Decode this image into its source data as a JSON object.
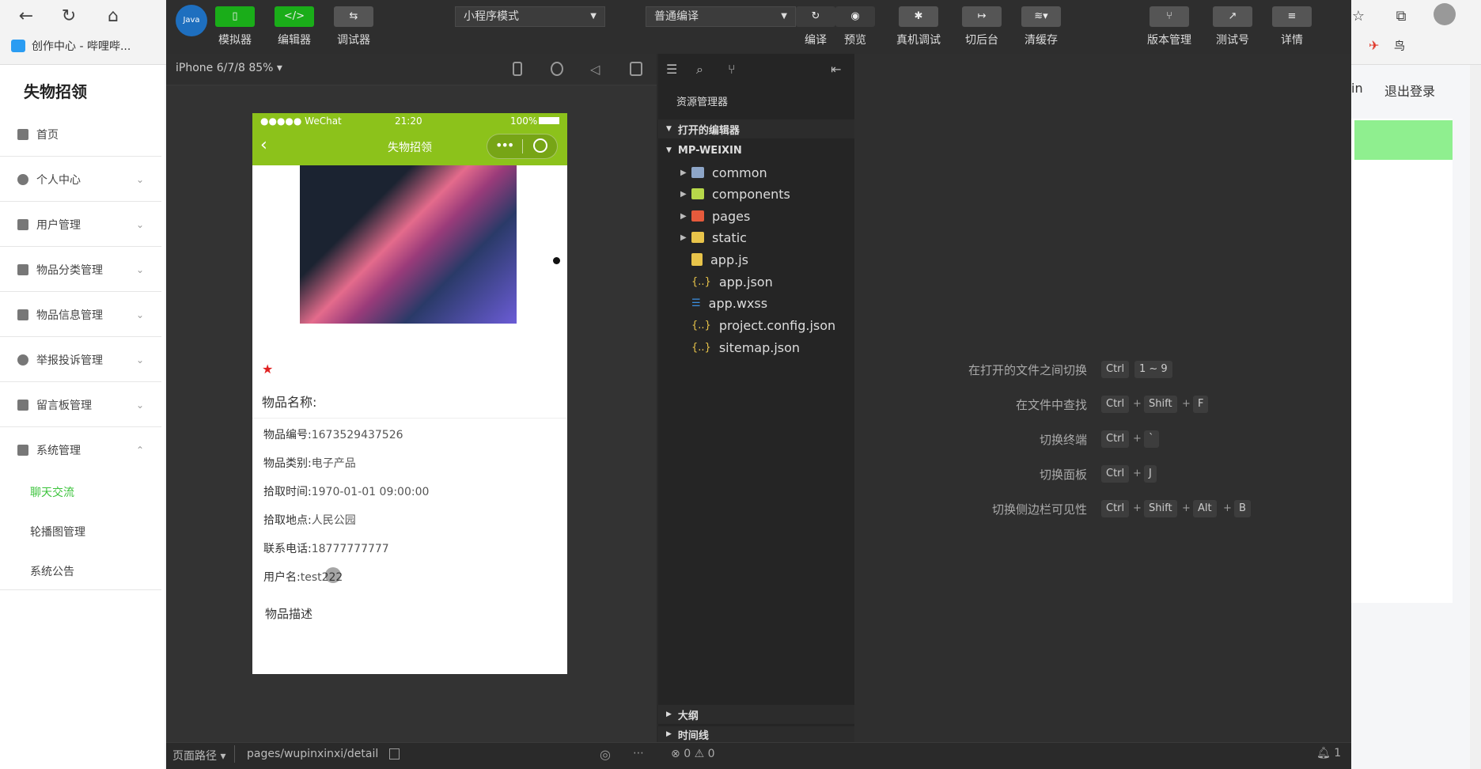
{
  "browser": {
    "bookmark_label": "创作中心 - 哔哩哔...",
    "right_user_text": "in",
    "logout": "退出登录"
  },
  "admin": {
    "brand": "失物招领",
    "menu": [
      {
        "label": "首页",
        "has_arrow": false
      },
      {
        "label": "个人中心",
        "has_arrow": true
      },
      {
        "label": "用户管理",
        "has_arrow": true
      },
      {
        "label": "物品分类管理",
        "has_arrow": true
      },
      {
        "label": "物品信息管理",
        "has_arrow": true
      },
      {
        "label": "举报投诉管理",
        "has_arrow": true
      },
      {
        "label": "留言板管理",
        "has_arrow": true
      },
      {
        "label": "系统管理",
        "has_arrow": true
      }
    ],
    "submenu": [
      "聊天交流",
      "轮播图管理",
      "系统公告"
    ],
    "submenu_active_color": "#3cc33c"
  },
  "devtools": {
    "app_icon_text": "Java",
    "toolbar": {
      "simulator": "模拟器",
      "editor": "编辑器",
      "debugger": "调试器",
      "mode": "小程序模式",
      "compile_mode": "普通编译",
      "compile": "编译",
      "preview": "预览",
      "real_debug": "真机调试",
      "background": "切后台",
      "clear_cache": "清缓存",
      "version": "版本管理",
      "test_account": "测试号",
      "details": "详情"
    },
    "device": "iPhone 6/7/8 85%",
    "status_bar": {
      "path_label": "页面路径",
      "path": "pages/wupinxinxi/detail",
      "errors": "0",
      "warnings": "0",
      "notifications": "1"
    }
  },
  "phone": {
    "carrier": "●●●●● WeChat",
    "time": "21:20",
    "battery": "100%",
    "title": "失物招领",
    "name_label": "物品名称:",
    "fields": [
      {
        "label": "物品编号:",
        "value": "1673529437526"
      },
      {
        "label": "物品类别:",
        "value": "电子产品"
      },
      {
        "label": "拾取时间:",
        "value": "1970-01-01 09:00:00"
      },
      {
        "label": "拾取地点:",
        "value": "人民公园"
      },
      {
        "label": "联系电话:",
        "value": "18777777777"
      },
      {
        "label": "用户名:",
        "value": "test222"
      }
    ],
    "desc_label": "物品描述",
    "theme_color": "#8cc21b"
  },
  "explorer": {
    "title": "资源管理器",
    "open_editors": "打开的编辑器",
    "project": "MP-WEIXIN",
    "items": [
      {
        "name": "common",
        "kind": "folder",
        "color": "#8ea6c8"
      },
      {
        "name": "components",
        "kind": "folder",
        "color": "#b7d84a"
      },
      {
        "name": "pages",
        "kind": "folder",
        "color": "#e65a3c"
      },
      {
        "name": "static",
        "kind": "folder",
        "color": "#e8c44a"
      },
      {
        "name": "app.js",
        "kind": "js"
      },
      {
        "name": "app.json",
        "kind": "json"
      },
      {
        "name": "app.wxss",
        "kind": "css"
      },
      {
        "name": "project.config.json",
        "kind": "json"
      },
      {
        "name": "sitemap.json",
        "kind": "json"
      }
    ],
    "outline": "大纲",
    "timeline": "时间线"
  },
  "shortcuts": [
    {
      "label": "在打开的文件之间切换",
      "keys": [
        "Ctrl",
        "1 ~ 9"
      ]
    },
    {
      "label": "在文件中查找",
      "keys": [
        "Ctrl",
        "Shift",
        "F"
      ]
    },
    {
      "label": "切换终端",
      "keys": [
        "Ctrl",
        "`"
      ]
    },
    {
      "label": "切换面板",
      "keys": [
        "Ctrl",
        "J"
      ]
    },
    {
      "label": "切换侧边栏可见性",
      "keys": [
        "Ctrl",
        "Shift",
        "Alt",
        "B"
      ]
    }
  ]
}
